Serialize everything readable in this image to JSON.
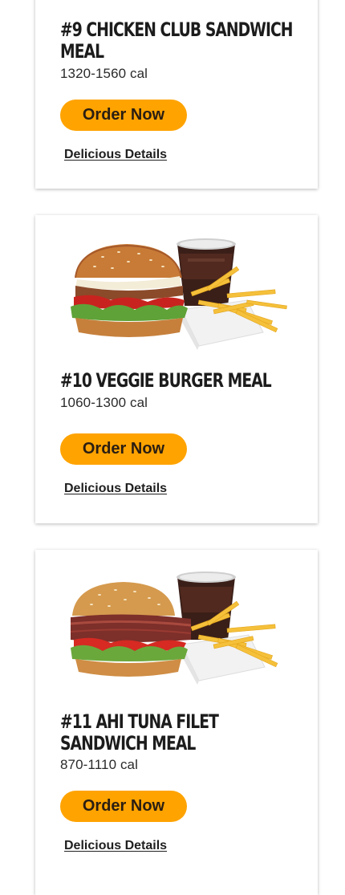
{
  "meals": [
    {
      "title": "#9 CHICKEN CLUB SANDWICH MEAL",
      "calories": "1320-1560 cal",
      "order_label": "Order Now",
      "details_label": "Delicious Details"
    },
    {
      "title": "#10 VEGGIE BURGER MEAL",
      "calories": "1060-1300 cal",
      "order_label": "Order Now",
      "details_label": "Delicious Details",
      "image": "veggie-burger-meal-photo"
    },
    {
      "title": "#11 AHI TUNA FILET SANDWICH MEAL",
      "calories": "870-1110 cal",
      "order_label": "Order Now",
      "details_label": "Delicious Details",
      "image": "ahi-tuna-sandwich-meal-photo"
    }
  ],
  "colors": {
    "order_button": "#ffa300",
    "card_background": "#ffffff",
    "text": "#1d1d1d"
  }
}
